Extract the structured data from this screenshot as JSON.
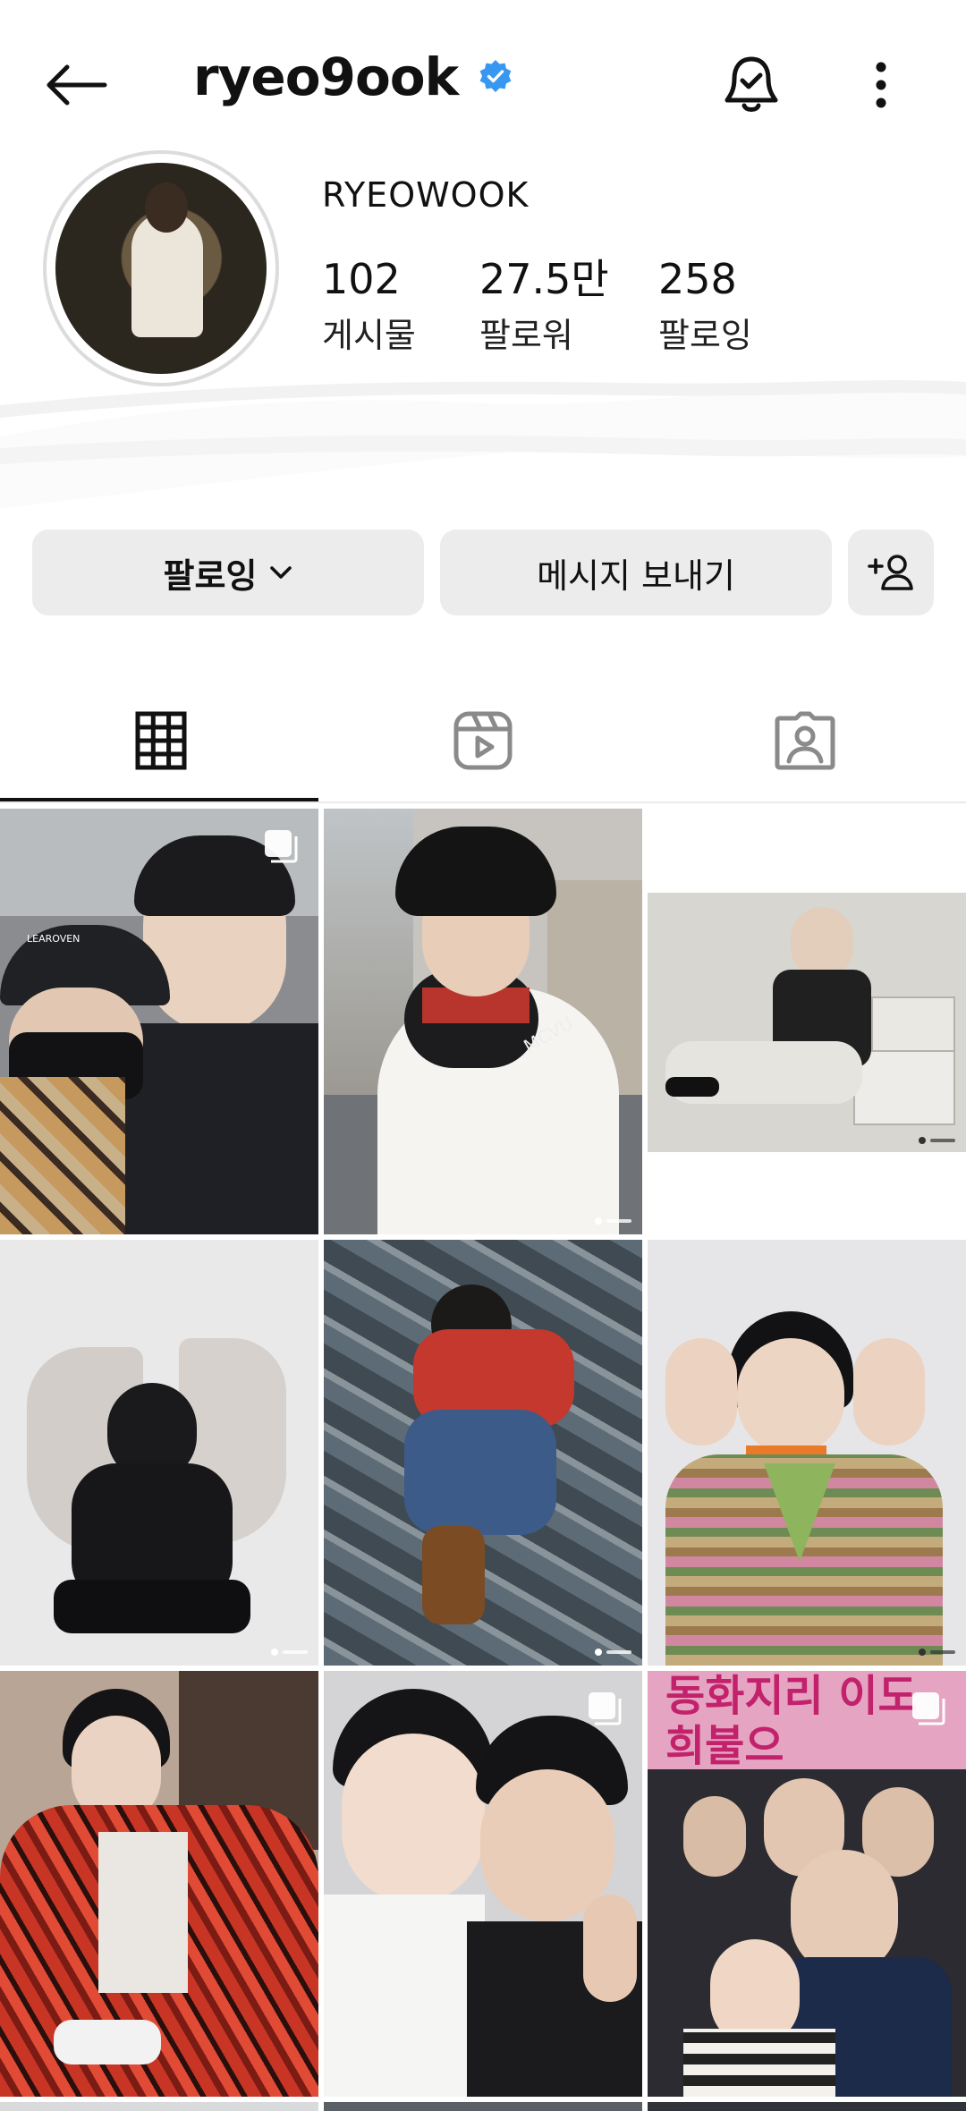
{
  "header": {
    "username": "ryeo9ook",
    "icons": {
      "back": "arrow-left-icon",
      "verified": "verified-badge-icon",
      "notifications": "bell-check-icon",
      "more": "more-vertical-icon"
    }
  },
  "profile": {
    "display_name": "RYEOWOOK",
    "stats": {
      "posts": {
        "value": "102",
        "label": "게시물"
      },
      "followers": {
        "value": "27.5만",
        "label": "팔로워"
      },
      "following": {
        "value": "258",
        "label": "팔로잉"
      }
    }
  },
  "actions": {
    "following_label": "팔로잉",
    "message_label": "메시지 보내기",
    "icons": {
      "dropdown": "chevron-down-icon",
      "add_user": "add-user-icon"
    }
  },
  "tabs": [
    {
      "name": "grid",
      "icon": "grid-icon",
      "active": true
    },
    {
      "name": "reels",
      "icon": "reels-icon",
      "active": false
    },
    {
      "name": "tagged",
      "icon": "tagged-user-icon",
      "active": false
    }
  ],
  "colors": {
    "verified": "#3897f0",
    "button_bg": "#ececec",
    "text": "#111111"
  },
  "posts": [
    {
      "carousel": true,
      "reel": false
    },
    {
      "carousel": false,
      "reel": true
    },
    {
      "carousel": false,
      "reel": true
    },
    {
      "carousel": false,
      "reel": true
    },
    {
      "carousel": false,
      "reel": true
    },
    {
      "carousel": false,
      "reel": true
    },
    {
      "carousel": false,
      "reel": false
    },
    {
      "carousel": true,
      "reel": false
    },
    {
      "carousel": true,
      "reel": false
    }
  ],
  "post_texts": {
    "cap_text": "LEAROVEN",
    "scarf_text": "MCVU",
    "banner_text": "동화지리 이도 희불으"
  }
}
